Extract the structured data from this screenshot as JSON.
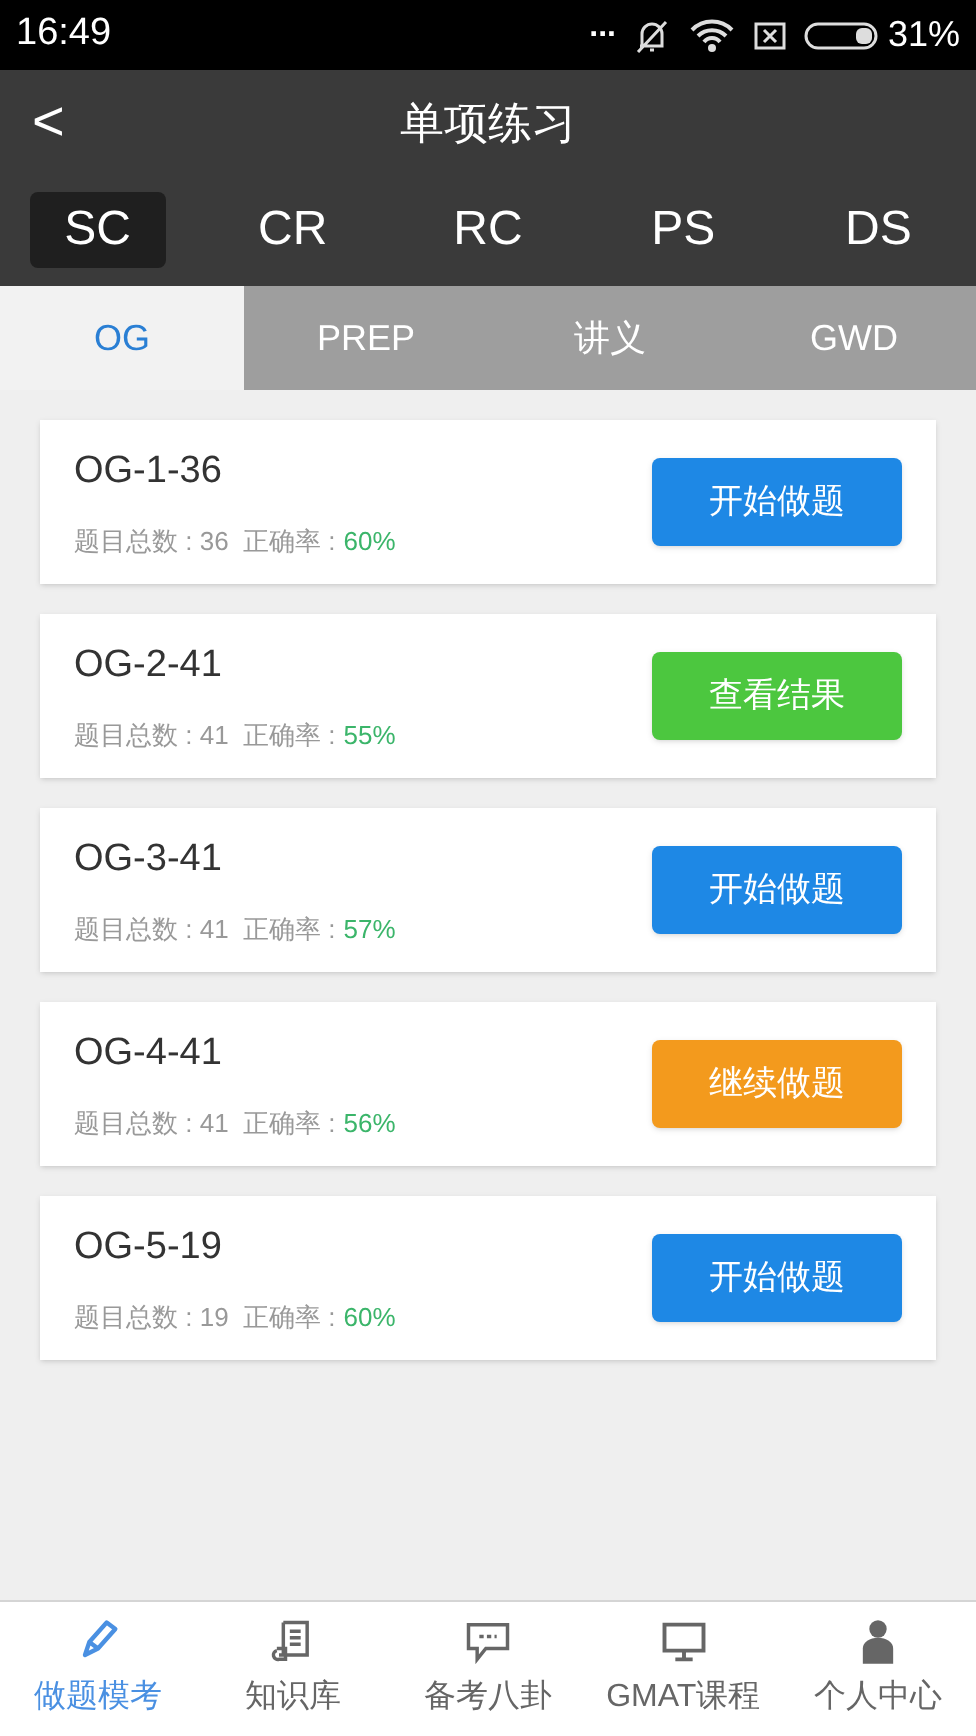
{
  "status_bar": {
    "time": "16:49",
    "dots": "...",
    "battery_text": "31%"
  },
  "header": {
    "back": "<",
    "title": "单项练习"
  },
  "subject_tabs": [
    {
      "label": "SC",
      "selected": true
    },
    {
      "label": "CR",
      "selected": false
    },
    {
      "label": "RC",
      "selected": false
    },
    {
      "label": "PS",
      "selected": false
    },
    {
      "label": "DS",
      "selected": false
    }
  ],
  "source_tabs": [
    {
      "label": "OG",
      "selected": true
    },
    {
      "label": "PREP",
      "selected": false
    },
    {
      "label": "讲义",
      "selected": false
    },
    {
      "label": "GWD",
      "selected": false
    }
  ],
  "sets": [
    {
      "title": "OG-1-36",
      "stats": "题目总数 : 36  正确率 :",
      "accuracy": "60%",
      "button": {
        "label": "开始做题",
        "kind": "start"
      }
    },
    {
      "title": "OG-2-41",
      "stats": "题目总数 : 41  正确率 :",
      "accuracy": "55%",
      "button": {
        "label": "查看结果",
        "kind": "result"
      }
    },
    {
      "title": "OG-3-41",
      "stats": "题目总数 : 41  正确率 :",
      "accuracy": "57%",
      "button": {
        "label": "开始做题",
        "kind": "start"
      }
    },
    {
      "title": "OG-4-41",
      "stats": "题目总数 : 41  正确率 :",
      "accuracy": "56%",
      "button": {
        "label": "继续做题",
        "kind": "continue"
      }
    },
    {
      "title": "OG-5-19",
      "stats": "题目总数 : 19  正确率 :",
      "accuracy": "60%",
      "button": {
        "label": "开始做题",
        "kind": "start"
      }
    }
  ],
  "bottom_nav": [
    {
      "label": "做题模考",
      "selected": true
    },
    {
      "label": "知识库",
      "selected": false
    },
    {
      "label": "备考八卦",
      "selected": false
    },
    {
      "label": "GMAT课程",
      "selected": false
    },
    {
      "label": "个人中心",
      "selected": false
    }
  ]
}
